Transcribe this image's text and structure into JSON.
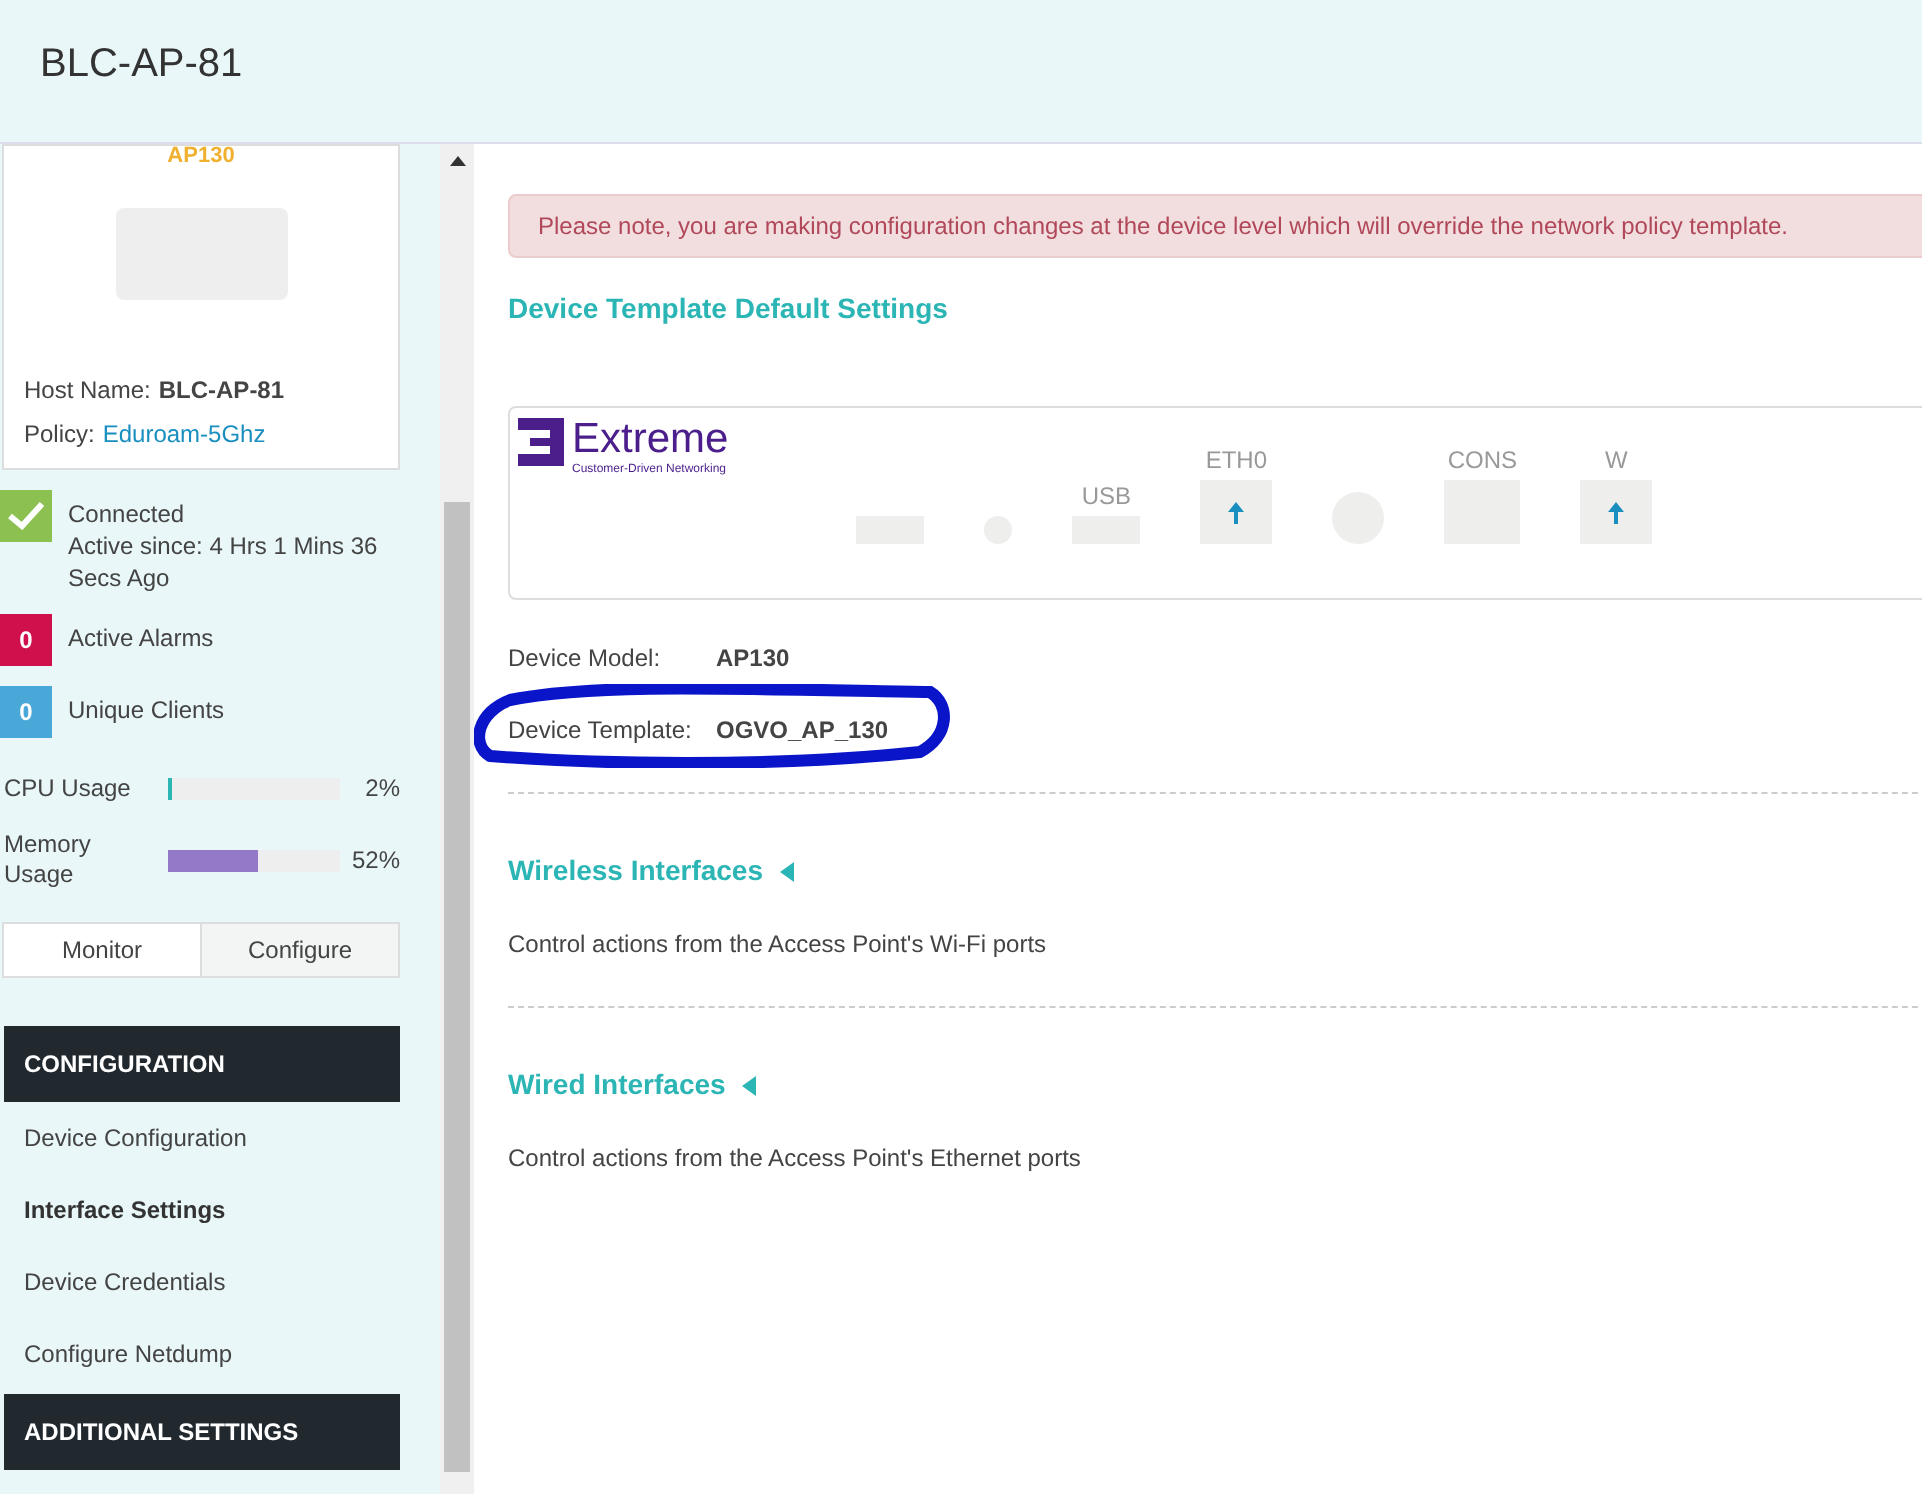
{
  "header": {
    "title": "BLC-AP-81"
  },
  "device_card": {
    "model": "AP130",
    "host_label": "Host Name:",
    "host_value": "BLC-AP-81",
    "policy_label": "Policy:",
    "policy_value": "Eduroam-5Ghz"
  },
  "status": [
    {
      "kind": "check",
      "color": "#8cc152",
      "title": "Connected",
      "detail": "Active since: 4 Hrs 1 Mins 36 Secs Ago"
    },
    {
      "kind": "count",
      "color": "#d0104c",
      "count": "0",
      "title": "Active Alarms"
    },
    {
      "kind": "count",
      "color": "#4aa8d8",
      "count": "0",
      "title": "Unique Clients"
    }
  ],
  "usage": [
    {
      "label": "CPU Usage",
      "level": 0.02,
      "reading": "2%",
      "color": "#2bb5b5"
    },
    {
      "label": "Memory Usage",
      "level": 0.52,
      "reading": "52%",
      "color": "#9579c9"
    }
  ],
  "mode_tabs": [
    {
      "label": "Monitor",
      "selected": false
    },
    {
      "label": "Configure",
      "selected": true
    }
  ],
  "nav": [
    {
      "heading": "CONFIGURATION",
      "items": [
        {
          "label": "Device Configuration",
          "selected": false
        },
        {
          "label": "Interface Settings",
          "selected": true
        },
        {
          "label": "Device Credentials",
          "selected": false
        },
        {
          "label": "Configure Netdump",
          "selected": false
        }
      ]
    },
    {
      "heading": "ADDITIONAL SETTINGS"
    }
  ],
  "notice": "Please note, you are making configuration changes at the device level which will override the network policy template.",
  "template_heading": "Device Template Default Settings",
  "device_panel": {
    "logo_name": "Extreme",
    "logo_tagline": "Customer-Driven Networking",
    "ports": [
      {
        "kind": "slot"
      },
      {
        "kind": "dot"
      },
      {
        "kind": "slot",
        "label": "USB"
      },
      {
        "kind": "eth",
        "label": "ETH0"
      },
      {
        "kind": "round"
      },
      {
        "kind": "console",
        "label": "CONS"
      },
      {
        "kind": "eth",
        "label": "W"
      }
    ]
  },
  "details": [
    {
      "label": "Device Model:",
      "value": "AP130",
      "circled": false
    },
    {
      "label": "Device Template:",
      "value": "OGVO_AP_130",
      "circled": true
    }
  ],
  "sections": [
    {
      "title": "Wireless Interfaces",
      "description": "Control actions from the Access Point's Wi-Fi ports",
      "expanded": false
    },
    {
      "title": "Wired Interfaces",
      "description": "Control actions from the Access Point's Ethernet ports",
      "expanded": false
    }
  ]
}
